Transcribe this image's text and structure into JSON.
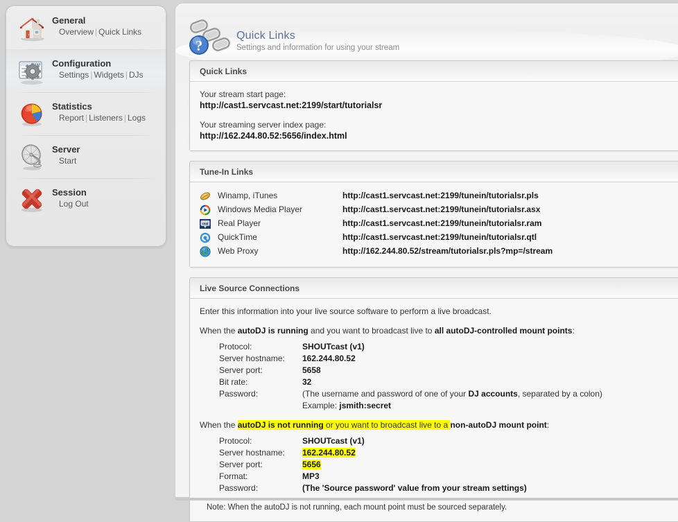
{
  "sidebar": {
    "groups": [
      {
        "icon": "house-icon",
        "title": "General",
        "links": [
          "Overview",
          "Quick Links"
        ],
        "active": false
      },
      {
        "icon": "window-gear-icon",
        "title": "Configuration",
        "links": [
          "Settings",
          "Widgets",
          "DJs"
        ],
        "active": true
      },
      {
        "icon": "pie-chart-icon",
        "title": "Statistics",
        "links": [
          "Report",
          "Listeners",
          "Logs"
        ],
        "active": false
      },
      {
        "icon": "satellite-dish-icon",
        "title": "Server",
        "links": [
          "Start"
        ],
        "active": false
      },
      {
        "icon": "red-x-icon",
        "title": "Session",
        "links": [
          "Log Out"
        ],
        "active": false
      }
    ],
    "separator": "|"
  },
  "header": {
    "icon": "chain-question-icon",
    "title": "Quick Links",
    "subtitle": "Settings and information for using your stream"
  },
  "quick_links": {
    "panel_title": "Quick Links",
    "start_page_label": "Your stream start page:",
    "start_page_url": "http://cast1.servcast.net:2199/start/tutorialsr",
    "index_page_label": "Your streaming server index page:",
    "index_page_url": "http://162.244.80.52:5656/index.html"
  },
  "tunein": {
    "panel_title": "Tune-In Links",
    "rows": [
      {
        "icon": "winamp-icon",
        "name": "Winamp, iTunes",
        "url": "http://cast1.servcast.net:2199/tunein/tutorialsr.pls"
      },
      {
        "icon": "wmp-icon",
        "name": "Windows Media Player",
        "url": "http://cast1.servcast.net:2199/tunein/tutorialsr.asx"
      },
      {
        "icon": "real-icon",
        "name": "Real Player",
        "url": "http://cast1.servcast.net:2199/tunein/tutorialsr.ram"
      },
      {
        "icon": "quicktime-icon",
        "name": "QuickTime",
        "url": "http://cast1.servcast.net:2199/tunein/tutorialsr.qtl"
      },
      {
        "icon": "globe-icon",
        "name": "Web Proxy",
        "url": "http://162.244.80.52/stream/tutorialsr.pls?mp=/stream"
      }
    ]
  },
  "live_source": {
    "panel_title": "Live Source Connections",
    "intro": "Enter this information into your live source software to perform a live broadcast.",
    "running": {
      "prefix": "When the ",
      "bold1": "autoDJ is running",
      "middle": " and you want to broadcast live to ",
      "bold2": "all autoDJ-controlled mount points",
      "suffix": ":",
      "rows": [
        {
          "key": "Protocol:",
          "value": "SHOUTcast (v1)"
        },
        {
          "key": "Server hostname:",
          "value": "162.244.80.52"
        },
        {
          "key": "Server port:",
          "value": "5658"
        },
        {
          "key": "Bit rate:",
          "value": "32"
        }
      ],
      "password_key": "Password:",
      "password_pre": "(The username and password of one of your ",
      "password_bold": "DJ accounts",
      "password_post": ", separated by a colon)",
      "example_label": "Example: ",
      "example_value": "jsmith:secret"
    },
    "not_running": {
      "prefix": "When the ",
      "bold1": "autoDJ is not running",
      "middle": " or you want to broadcast live to a ",
      "bold2": "non-autoDJ mount point",
      "suffix": ":",
      "rows": [
        {
          "key": "Protocol:",
          "value": "SHOUTcast (v1)",
          "highlight": false
        },
        {
          "key": "Server hostname:",
          "value": "162.244.80.52",
          "highlight": true
        },
        {
          "key": "Server port:",
          "value": "5656",
          "highlight": true
        },
        {
          "key": "Format:",
          "value": "MP3",
          "highlight": false
        },
        {
          "key": "Password:",
          "value": "(The 'Source password' value from your stream settings)",
          "highlight": false
        }
      ]
    },
    "note": "Note: When the autoDJ is not running, each mount point must be sourced separately."
  },
  "colors": {
    "page_background": "#d4d4d4",
    "panel_background": "#f4f4f4",
    "highlight": "#ffff00",
    "header_title": "#5b7196"
  }
}
